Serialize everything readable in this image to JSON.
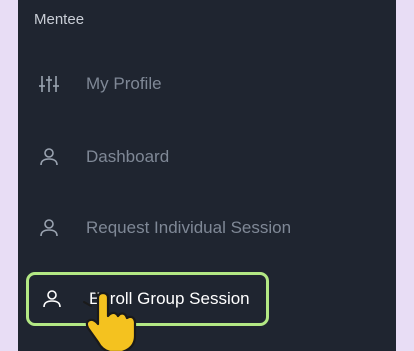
{
  "sidebar": {
    "section_label": "Mentee",
    "items": [
      {
        "label": "My Profile",
        "icon": "sliders-icon"
      },
      {
        "label": "Dashboard",
        "icon": "user-icon"
      },
      {
        "label": "Request Individual Session",
        "icon": "user-icon"
      },
      {
        "label": "Enroll Group Session",
        "icon": "user-icon",
        "active": true
      }
    ],
    "highlight_color": "#b3e884"
  }
}
